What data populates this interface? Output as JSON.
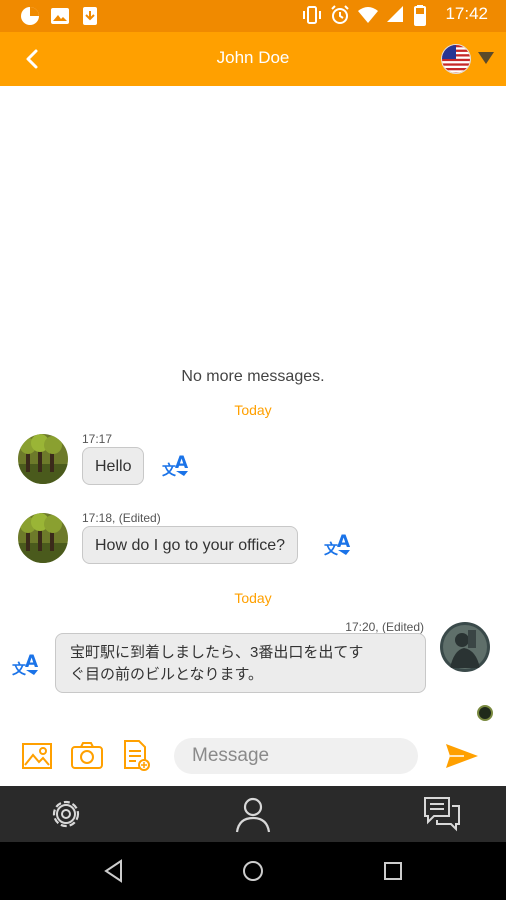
{
  "status_bar": {
    "time": "17:42",
    "left_icons": [
      "pie-chart-icon",
      "image-icon",
      "download-icon"
    ],
    "right_icons": [
      "vibrate-icon",
      "alarm-icon",
      "wifi-icon",
      "signal-icon",
      "battery-icon"
    ]
  },
  "app_bar": {
    "title": "John Doe",
    "back_icon": "back-arrow-icon",
    "language_flag": "us-flag-icon",
    "dropdown_icon": "caret-down-icon"
  },
  "chat": {
    "no_more_label": "No more messages.",
    "messages": [
      {
        "day_label": "Today"
      },
      {
        "time": "17:17",
        "text": "Hello",
        "side": "left"
      },
      {
        "time": "17:18, (Edited)",
        "text": "How do I go to your office?",
        "side": "left"
      },
      {
        "day_label": "Today"
      },
      {
        "time": "17:20, (Edited)",
        "text": "宝町駅に到着しましたら、3番出口を出てすぐ目の前のビルとなります。",
        "side": "right"
      }
    ],
    "text_lines_3": [
      "宝町駅に到着しましたら、3番出口を出てす",
      "ぐ目の前のビルとなります。"
    ]
  },
  "input_bar": {
    "placeholder": "Message",
    "buttons": [
      "gallery-icon",
      "camera-icon",
      "file-icon",
      "send-icon"
    ]
  },
  "tab_bar": {
    "items": [
      "settings-icon",
      "profile-icon",
      "chats-icon"
    ]
  },
  "nav_bar": {
    "items": [
      "back-triangle-icon",
      "home-circle-icon",
      "recents-square-icon"
    ]
  },
  "colors": {
    "status_bar": "#f08a00",
    "app_bar": "#ffa000",
    "accent": "#ffa000",
    "translate_blue": "#1a73e8",
    "bubble_bg": "#ececec",
    "tab_bar": "#2a2a2a"
  }
}
